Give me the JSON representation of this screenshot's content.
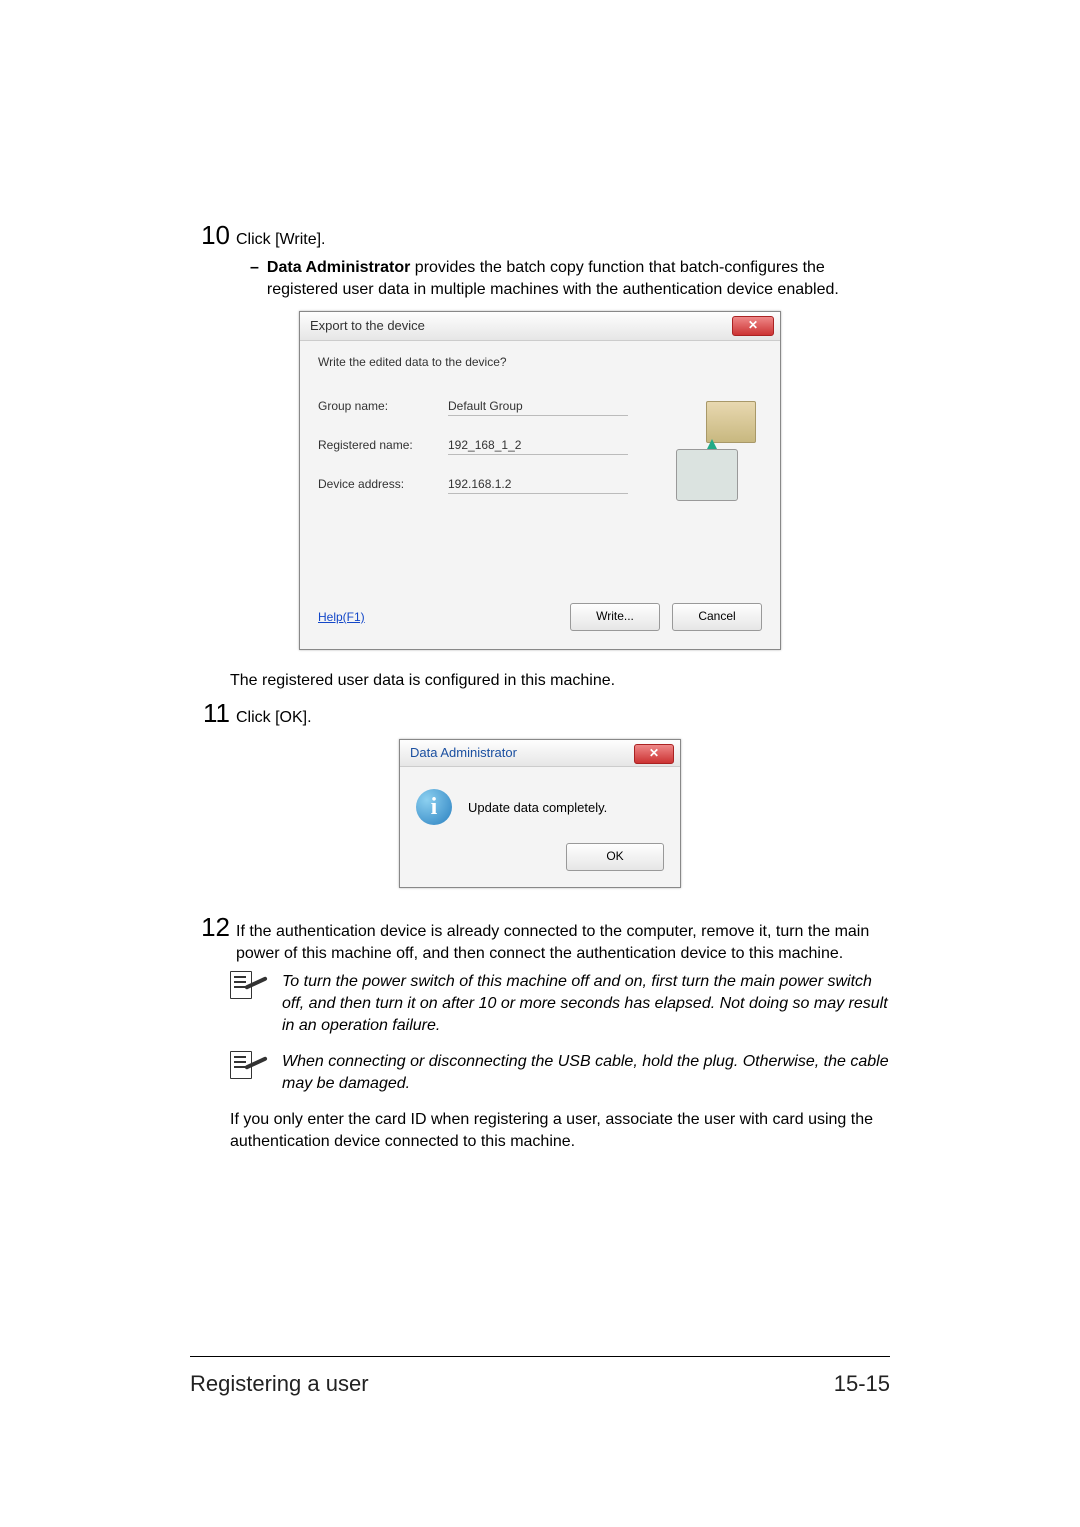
{
  "step10": {
    "num": "10",
    "text": "Click [Write].",
    "bullet_prefix": "–",
    "bullet_bold": "Data Administrator",
    "bullet_rest": " provides the batch copy function that batch-configures the registered user data in multiple machines with the authentication device enabled."
  },
  "export_dialog": {
    "title": "Export to the device",
    "close": "✕",
    "question": "Write the edited data to the device?",
    "group_label": "Group name:",
    "group_value": "Default Group",
    "reg_label": "Registered name:",
    "reg_value": "192_168_1_2",
    "addr_label": "Device address:",
    "addr_value": "192.168.1.2",
    "help": "Help(F1)",
    "write_btn": "Write...",
    "cancel_btn": "Cancel"
  },
  "between_text": "The registered user data is configured in this machine.",
  "step11": {
    "num": "11",
    "text": "Click [OK]."
  },
  "ok_dialog": {
    "title": "Data Administrator",
    "close": "✕",
    "info": "i",
    "message": "Update data completely.",
    "ok_btn": "OK"
  },
  "step12": {
    "num": "12",
    "text": "If the authentication device is already connected to the computer, remove it, turn the main power of this machine off, and then connect the authentication device to this machine."
  },
  "note1": "To turn the power switch of this machine off and on, first turn the main power switch off, and then turn it on after 10 or more seconds has elapsed. Not doing so may result in an operation failure.",
  "note2": "When connecting or disconnecting the USB cable, hold the plug. Otherwise, the cable may be damaged.",
  "closing": "If you only enter the card ID when registering a user, associate the user with card using the authentication device connected to this machine.",
  "footer": {
    "left": "Registering a user",
    "right": "15-15"
  }
}
